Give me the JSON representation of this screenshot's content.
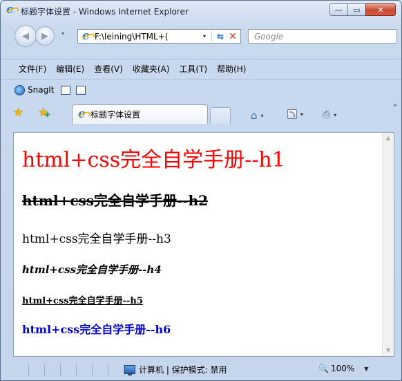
{
  "window": {
    "title": "标题字体设置 - Windows Internet Explorer",
    "minimize_glyph": "—",
    "restore_glyph": "▭",
    "close_glyph": "✕"
  },
  "address_bar": {
    "url": "F:\\leining\\HTML+(",
    "dropdown_glyph": "▾",
    "refresh_glyph": "⇆",
    "stop_glyph": "✕"
  },
  "search": {
    "placeholder": "Google"
  },
  "nav": {
    "back_glyph": "◀",
    "forward_glyph": "▶",
    "dropdown_glyph": "▾"
  },
  "menubar": {
    "items": [
      "文件(F)",
      "编辑(E)",
      "查看(V)",
      "收藏夹(A)",
      "工具(T)",
      "帮助(H)"
    ]
  },
  "snagit": {
    "label": "SnagIt"
  },
  "tabs": {
    "active_label": "标题字体设置",
    "favorites_star": "★",
    "add_favorite_star": "★",
    "add_favorite_plus": "+",
    "more_glyph": "»"
  },
  "commands": {
    "home_glyph": "⌂",
    "print_glyph": "⎙",
    "dropdown_glyph": "▾"
  },
  "content": {
    "h1": "html+css完全自学手册--h1",
    "h2": "html+css完全自学手册--h2",
    "h3": "html+css完全自学手册--h3",
    "h4": "html+css完全自学手册--h4",
    "h5": "html+css完全自学手册--h5",
    "h6": "html+css完全自学手册--h6"
  },
  "scrollbar": {
    "up_glyph": "▲",
    "down_glyph": "▼"
  },
  "status": {
    "zone_text": "计算机 | 保护模式: 禁用",
    "zoom_glyph": "🔍",
    "zoom": "100%",
    "zoom_dropdown": "▼"
  },
  "colors": {
    "h1": "#ff0000",
    "h6": "#0000cc",
    "frame": "#c4d5ec"
  }
}
